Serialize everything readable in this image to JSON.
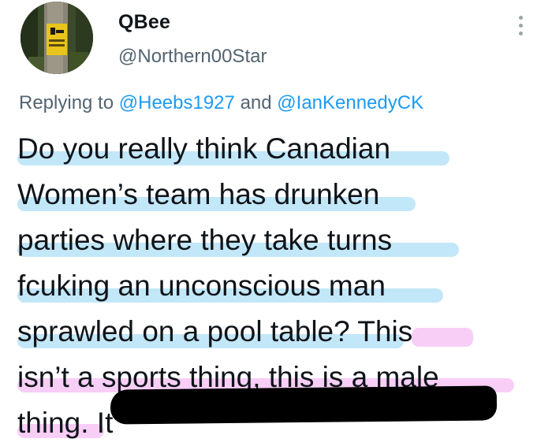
{
  "author": {
    "display_name": "QBee",
    "handle": "@Northern00Star"
  },
  "reply": {
    "prefix": "Replying to",
    "mentions": [
      "@Heebs1927",
      "@IanKennedyCK"
    ],
    "conjunction": "and"
  },
  "tweet": {
    "lines": [
      "Do you really think Canadian",
      "Women’s team has drunken",
      "parties where they take turns",
      "fcuking an unconscious man",
      "sprawled on a pool table? This",
      "isn’t a sports thing, this is a male",
      "thing. It"
    ]
  },
  "colors": {
    "highlight_blue": "#8fd3f2",
    "highlight_pink": "#f2a6ef",
    "mention": "#1d9bf0",
    "secondary_text": "#536471"
  },
  "icons": {
    "more": "more-options-icon",
    "avatar": "avatar-image"
  }
}
